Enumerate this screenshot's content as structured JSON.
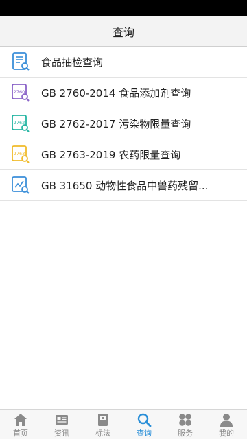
{
  "header": {
    "title": "查询"
  },
  "list": {
    "items": [
      {
        "label": "食品抽检查询",
        "icon": "document-search-icon",
        "color": "#3b8fd9"
      },
      {
        "label": "GB 2760-2014 食品添加剂查询",
        "icon": "standard-2760-icon",
        "icon_text": "2760",
        "color": "#8a63c8"
      },
      {
        "label": "GB 2762-2017 污染物限量查询",
        "icon": "standard-2762-icon",
        "icon_text": "2762",
        "color": "#25b5a3"
      },
      {
        "label": "GB 2763-2019 农药限量查询",
        "icon": "standard-2763-icon",
        "icon_text": "2763",
        "color": "#f0bb2a"
      },
      {
        "label": "GB 31650 动物性食品中兽药残留...",
        "icon": "chart-search-icon",
        "color": "#3b8fd9"
      }
    ]
  },
  "tabs": [
    {
      "label": "首页",
      "icon": "home-icon"
    },
    {
      "label": "资讯",
      "icon": "news-icon"
    },
    {
      "label": "标法",
      "icon": "book-icon"
    },
    {
      "label": "查询",
      "icon": "search-icon",
      "active": true
    },
    {
      "label": "服务",
      "icon": "services-icon"
    },
    {
      "label": "我的",
      "icon": "user-icon"
    }
  ],
  "colors": {
    "active_tab": "#2a8fd8",
    "inactive_tab": "#8a8a8a"
  }
}
